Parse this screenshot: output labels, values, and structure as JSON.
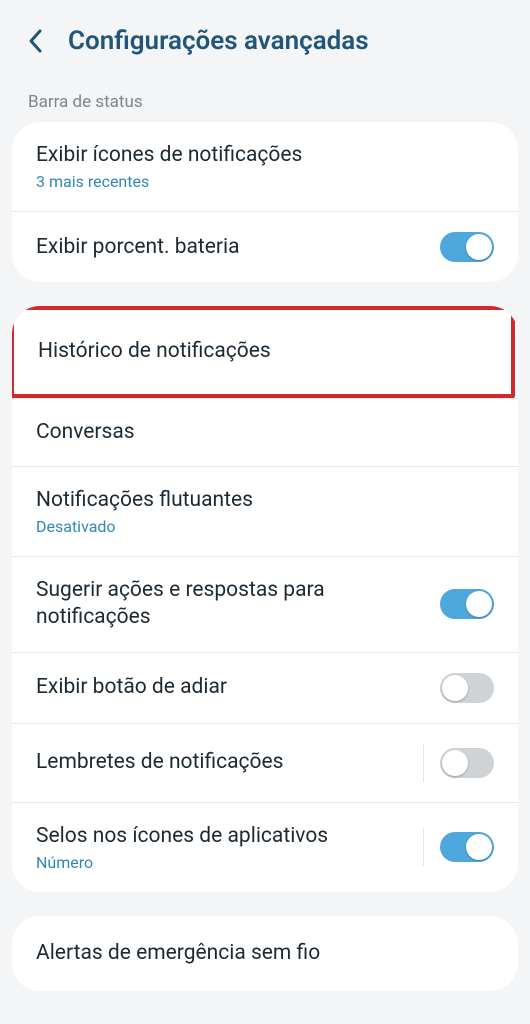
{
  "header": {
    "title": "Configurações avançadas"
  },
  "section1": {
    "label": "Barra de status",
    "notif_icons": {
      "title": "Exibir ícones de notificações",
      "sub": "3 mais recentes"
    },
    "battery": {
      "title": "Exibir porcent. bateria"
    }
  },
  "section2": {
    "history": {
      "title": "Histórico de notificações"
    },
    "conversations": {
      "title": "Conversas"
    },
    "floating": {
      "title": "Notificações flutuantes",
      "sub": "Desativado"
    },
    "suggest": {
      "title": "Sugerir ações e respostas para notificações"
    },
    "snooze": {
      "title": "Exibir botão de adiar"
    },
    "reminders": {
      "title": "Lembretes de notificações"
    },
    "badges": {
      "title": "Selos nos ícones de aplicativos",
      "sub": "Número"
    }
  },
  "section3": {
    "emergency": {
      "title": "Alertas de emergência sem fio"
    }
  }
}
